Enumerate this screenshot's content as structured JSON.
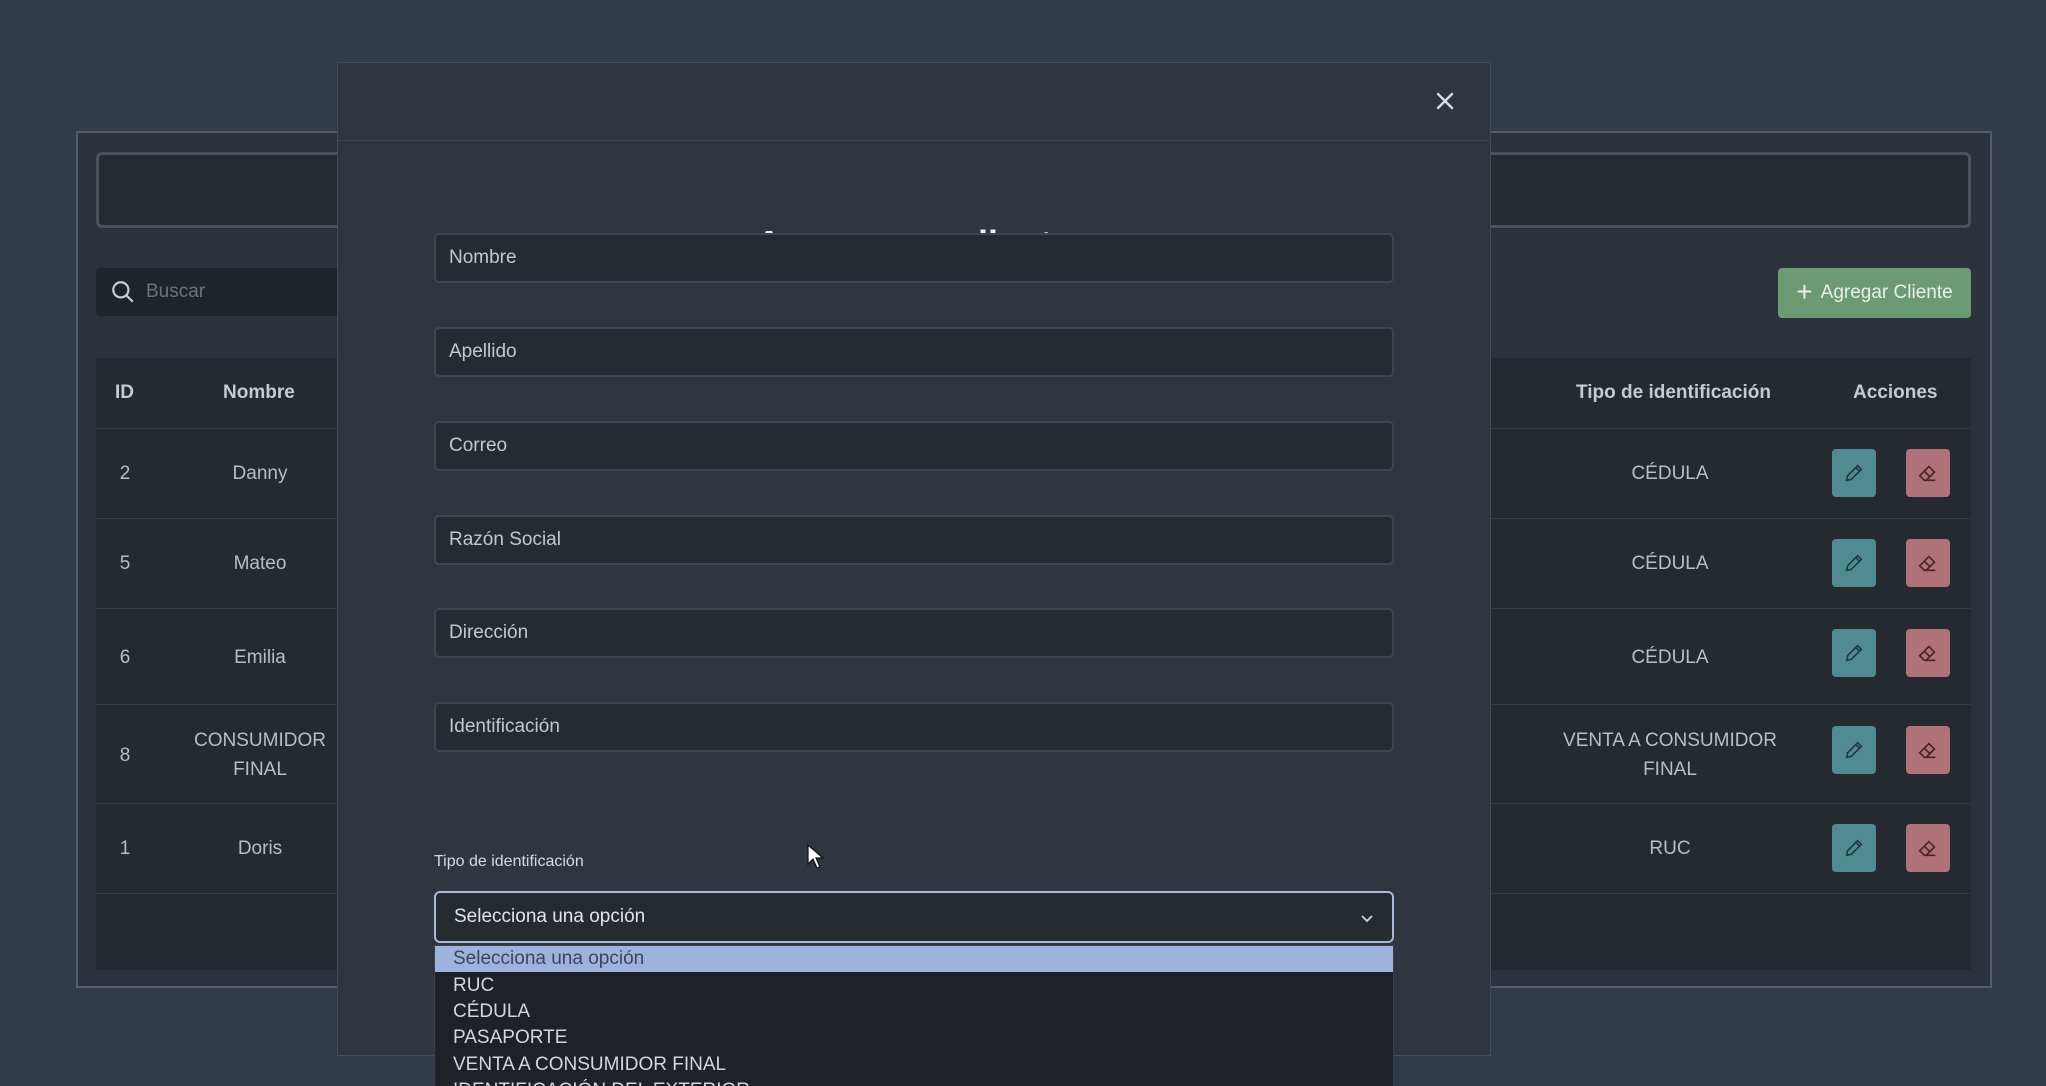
{
  "search": {
    "placeholder": "Buscar"
  },
  "toolbar": {
    "add_client_label": "Agregar Cliente"
  },
  "table": {
    "headers": {
      "id": "ID",
      "nombre": "Nombre",
      "tipo": "Tipo de identificación",
      "acciones": "Acciones"
    },
    "rows": [
      {
        "id": "2",
        "nombre": "Danny",
        "tipo": "CÉDULA"
      },
      {
        "id": "5",
        "nombre": "Mateo",
        "tipo": "CÉDULA"
      },
      {
        "id": "6",
        "nombre": "Emilia",
        "tipo": "CÉDULA"
      },
      {
        "id": "8",
        "nombre": "CONSUMIDOR FINAL",
        "tipo": "VENTA A CONSUMIDOR FINAL"
      },
      {
        "id": "1",
        "nombre": "Doris",
        "tipo": "RUC"
      }
    ]
  },
  "modal": {
    "title": "Agregar un cliente",
    "fields": {
      "nombre": "Nombre",
      "apellido": "Apellido",
      "correo": "Correo",
      "razon_social": "Razón Social",
      "direccion": "Dirección",
      "identificacion": "Identificación"
    },
    "select": {
      "label": "Tipo de identificación",
      "value": "Selecciona una opción",
      "options": [
        "Selecciona una opción",
        "RUC",
        "CÉDULA",
        "PASAPORTE",
        "VENTA A CONSUMIDOR FINAL",
        "IDENTIFICACIÓN DEL EXTERIOR"
      ]
    }
  },
  "colors": {
    "add_button": "#6c9a73",
    "edit_button": "#4f8b91",
    "delete_button": "#b0727a",
    "select_highlight": "#9db3de"
  },
  "icons": {
    "search": "search-icon",
    "plus": "plus-icon",
    "edit": "pencil-icon",
    "delete": "eraser-icon",
    "close": "close-icon",
    "chevron": "chevron-down-icon",
    "cursor": "mouse-cursor-icon"
  }
}
